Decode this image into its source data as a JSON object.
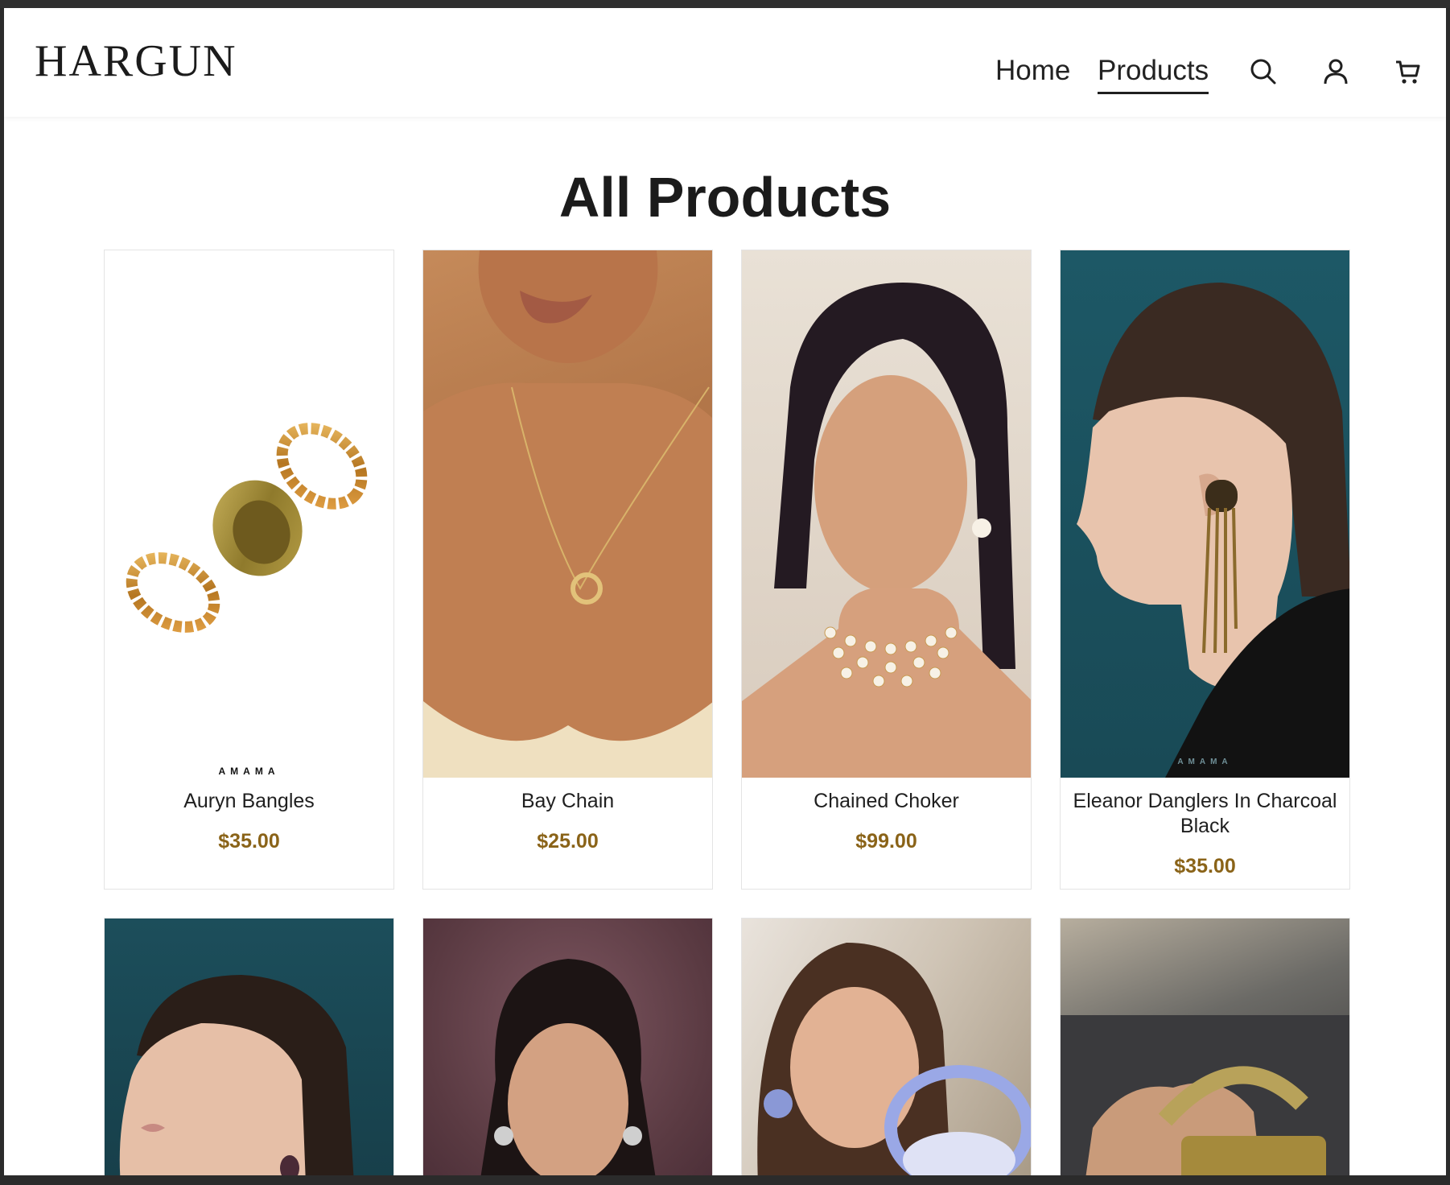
{
  "header": {
    "logo": "HARGUN",
    "nav": [
      {
        "label": "Home",
        "active": false
      },
      {
        "label": "Products",
        "active": true
      }
    ],
    "icons": [
      "search-icon",
      "account-icon",
      "cart-icon"
    ]
  },
  "main": {
    "title": "All Products",
    "products": [
      {
        "name": "Auryn Bangles",
        "price": "$35.00",
        "watermark": "AMAMA"
      },
      {
        "name": "Bay Chain",
        "price": "$25.00"
      },
      {
        "name": "Chained Choker",
        "price": "$99.00"
      },
      {
        "name": "Eleanor Danglers In Charcoal Black",
        "price": "$35.00",
        "watermark": "AMAMA"
      },
      {
        "name": "",
        "price": ""
      },
      {
        "name": "",
        "price": ""
      },
      {
        "name": "",
        "price": ""
      },
      {
        "name": "",
        "price": ""
      }
    ]
  },
  "colors": {
    "price": "#8a6318",
    "text": "#1f1f1f",
    "border": "#e4e4e4"
  }
}
